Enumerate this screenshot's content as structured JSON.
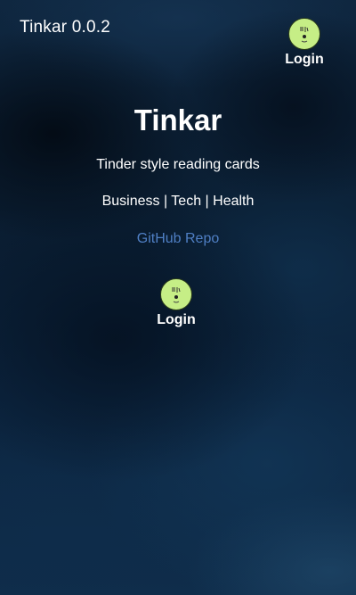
{
  "header": {
    "app_version": "Tinkar 0.0.2",
    "login_label": "Login"
  },
  "hero": {
    "title": "Tinkar",
    "tagline": "Tinder style reading cards",
    "categories": "Business | Tech | Health",
    "repo_link": "GitHub Repo",
    "login_label": "Login"
  },
  "icons": {
    "login_avatar": "avatar-icon"
  },
  "colors": {
    "avatar_bg": "#c6ee86",
    "link": "#4f7fc4",
    "text": "#ffffff"
  }
}
